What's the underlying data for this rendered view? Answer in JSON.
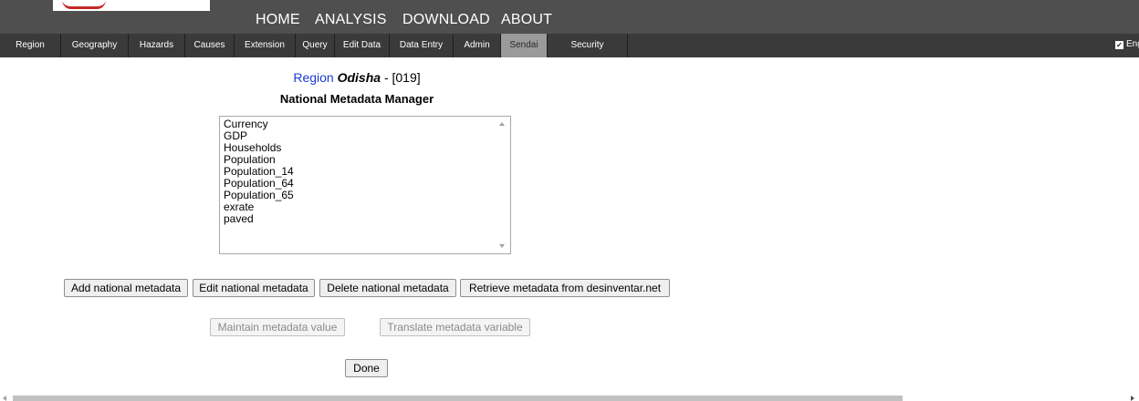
{
  "top_nav": {
    "items": [
      {
        "label": "HOME"
      },
      {
        "label": "ANALYSIS"
      },
      {
        "label": "DOWNLOAD"
      },
      {
        "label": "ABOUT"
      }
    ]
  },
  "tabs": [
    {
      "label": "Region"
    },
    {
      "label": "Geography"
    },
    {
      "label": "Hazards"
    },
    {
      "label": "Causes"
    },
    {
      "label": "Extension"
    },
    {
      "label": "Query"
    },
    {
      "label": "Edit Data"
    },
    {
      "label": "Data Entry"
    },
    {
      "label": "Admin"
    },
    {
      "label": "Sendai",
      "active": true
    },
    {
      "label": "Security"
    }
  ],
  "language": {
    "checkbox_mark": "✔",
    "label": "Eng"
  },
  "heading": {
    "region_label": "Region",
    "region_name": "Odisha",
    "region_code": "- [019]",
    "subtitle": "National Metadata Manager"
  },
  "metadata_list": [
    "Currency",
    "GDP",
    "Households",
    "Population",
    "Population_14",
    "Population_64",
    "Population_65",
    "exrate",
    "paved"
  ],
  "buttons": {
    "add": "Add national metadata",
    "edit": "Edit national metadata",
    "delete": "Delete national metadata",
    "retrieve": "Retrieve metadata from desinventar.net",
    "maintain": "Maintain metadata value",
    "translate": "Translate metadata variable",
    "done": "Done"
  },
  "colors": {
    "header_bg": "#4f4f4f",
    "tabbar_bg": "#3a3a3a",
    "active_tab_bg": "#9a9a9a",
    "region_label": "#1a3ccf",
    "logo_accent": "#c62828"
  }
}
